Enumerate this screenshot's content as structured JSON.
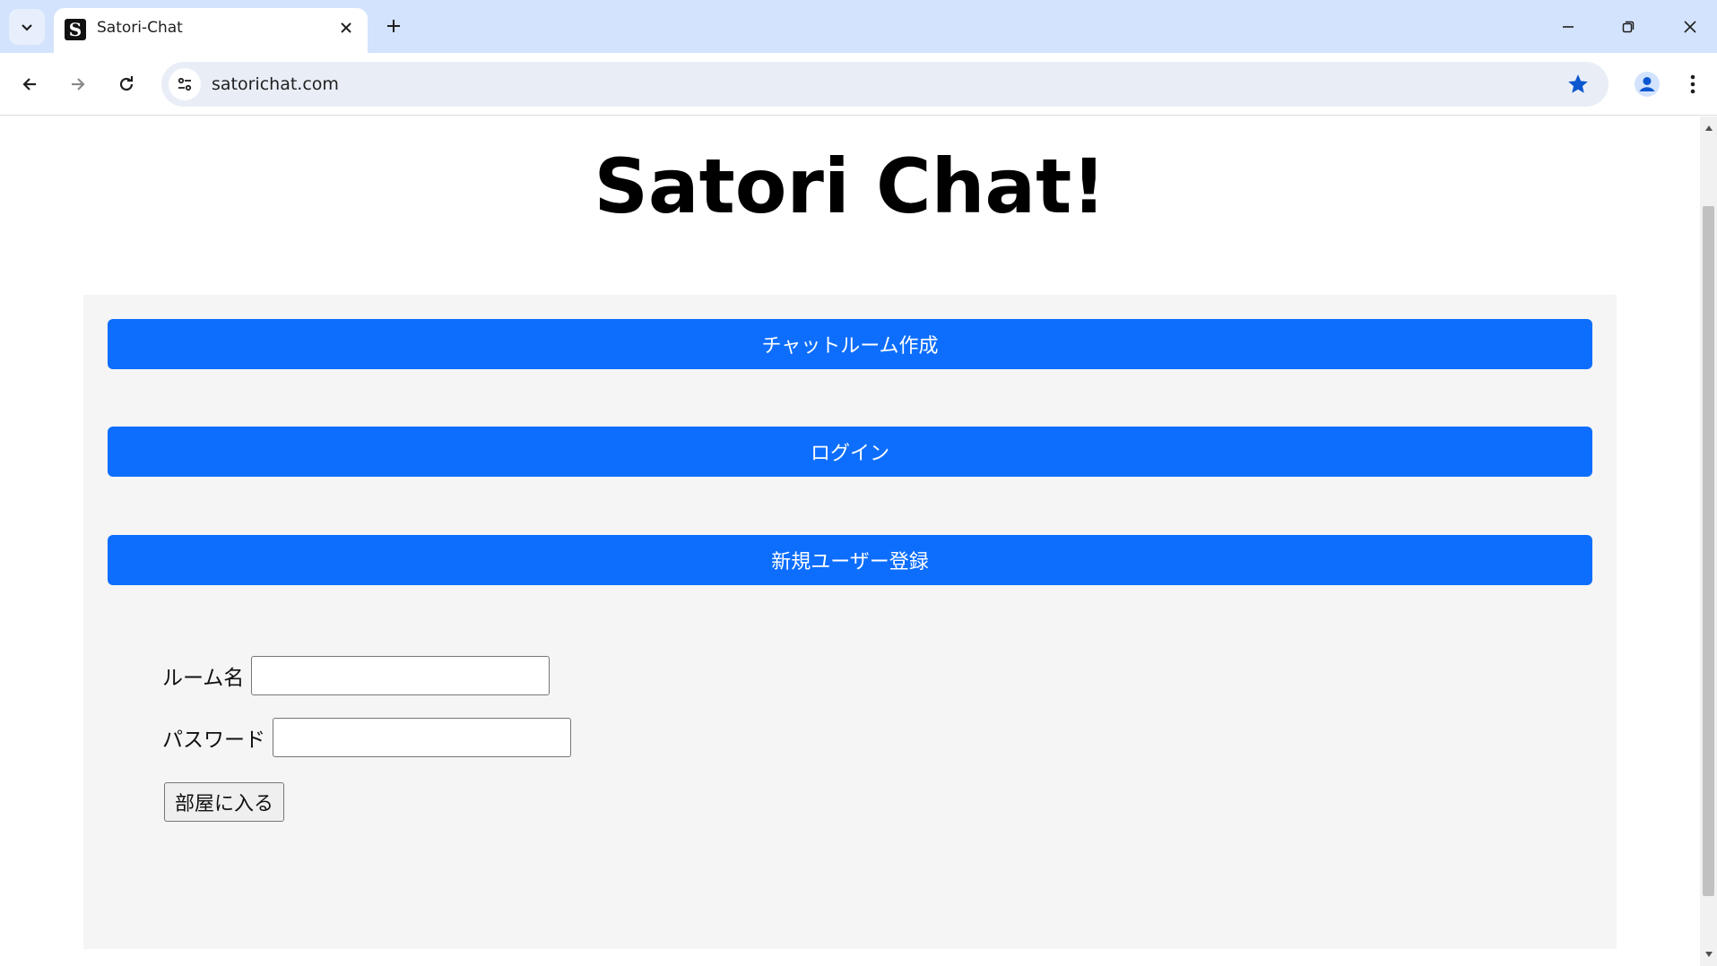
{
  "browser": {
    "tab": {
      "title": "Satori-Chat",
      "favicon_letter": "S"
    },
    "address_bar": {
      "url": "satorichat.com"
    },
    "icons": {
      "tab_search": "chevron-down-icon",
      "tab_close": "close-icon",
      "new_tab": "plus-icon",
      "back": "back-arrow-icon",
      "forward": "forward-arrow-icon",
      "reload": "reload-icon",
      "site_info": "tune-icon",
      "bookmark": "star-icon",
      "profile": "profile-icon",
      "menu": "kebab-menu-icon"
    },
    "colors": {
      "tabstrip": "#d3e3fd",
      "omnibox": "#e9eef6",
      "accent": "#0b57d0"
    }
  },
  "page": {
    "title": "Satori Chat!",
    "buttons": {
      "create_room": "チャットルーム作成",
      "login": "ログイン",
      "register": "新規ユーザー登録"
    },
    "form": {
      "room_name_label": "ルーム名",
      "room_name_value": "",
      "password_label": "パスワード",
      "password_value": "",
      "submit_label": "部屋に入る"
    },
    "colors": {
      "primary_button": "#0d6efd",
      "panel": "#f5f5f5"
    }
  }
}
